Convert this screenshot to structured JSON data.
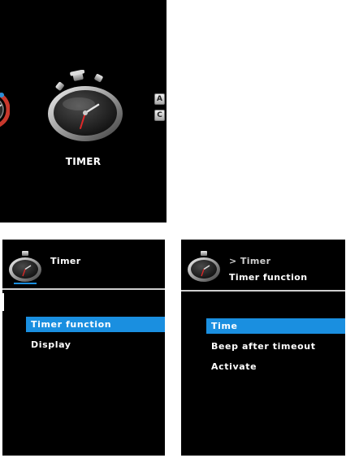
{
  "screens": {
    "carousel": {
      "label": "TIMER",
      "side_keys": [
        "A",
        "C"
      ],
      "icons": {
        "main": "stopwatch-icon",
        "previous": "gauge-icon"
      }
    },
    "timer_menu": {
      "header": {
        "title": "Timer",
        "icon": "stopwatch-icon"
      },
      "items": [
        {
          "label": "Timer function",
          "selected": true
        },
        {
          "label": "Display",
          "selected": false
        }
      ]
    },
    "timer_function_menu": {
      "header": {
        "breadcrumb": "> Timer",
        "title": "Timer function",
        "icon": "stopwatch-icon"
      },
      "items": [
        {
          "label": "Time",
          "selected": true
        },
        {
          "label": "Beep after timeout",
          "selected": false
        },
        {
          "label": "Activate",
          "selected": false
        }
      ]
    }
  },
  "colors": {
    "screen_bg": "#000000",
    "highlight": "#1a8fe0",
    "text": "#ffffff",
    "divider": "#cfcfcf"
  }
}
